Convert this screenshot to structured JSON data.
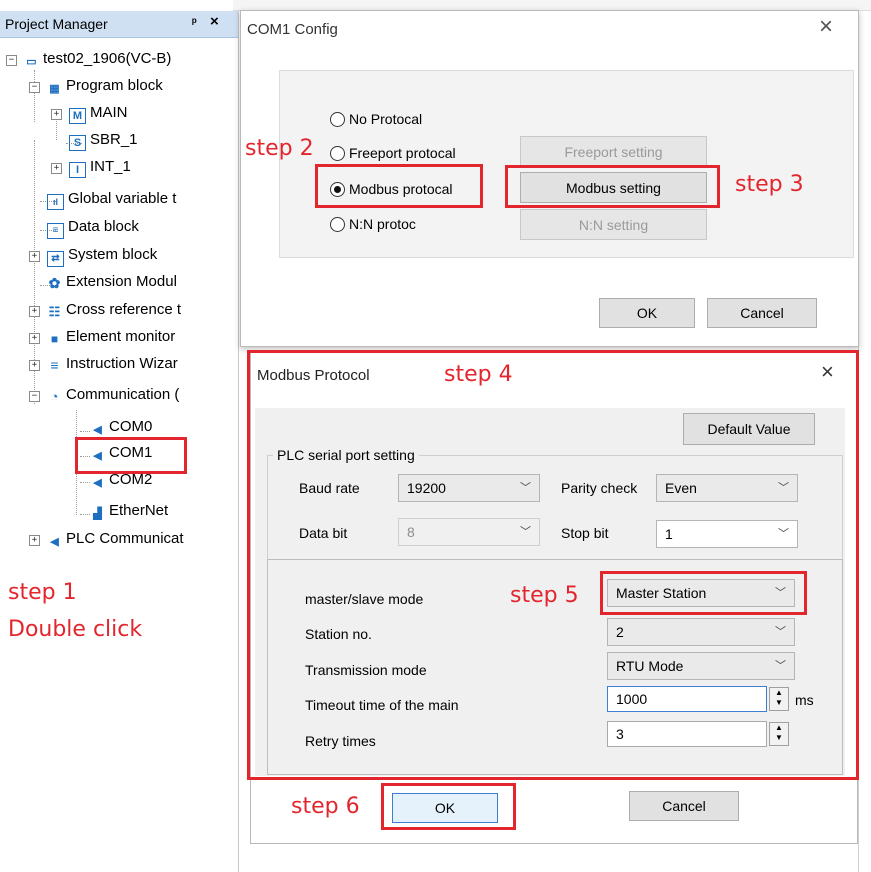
{
  "project_manager": {
    "title": "Project Manager",
    "pin_icon": "pin-icon",
    "close_icon": "close-icon",
    "items": [
      {
        "label": "test02_1906(VC-B)",
        "icon": "computer-icon"
      },
      {
        "label": "Program block",
        "icon": "program-block-icon"
      },
      {
        "label": "MAIN",
        "icon": "main-icon"
      },
      {
        "label": "SBR_1",
        "icon": "subroutine-icon"
      },
      {
        "label": "INT_1",
        "icon": "interrupt-icon"
      },
      {
        "label": "Global variable t",
        "icon": "chart-icon"
      },
      {
        "label": "Data block",
        "icon": "document-icon"
      },
      {
        "label": "System block",
        "icon": "system-block-icon"
      },
      {
        "label": "Extension Modul",
        "icon": "gear-icon"
      },
      {
        "label": "Cross reference t",
        "icon": "table-icon"
      },
      {
        "label": "Element monitor",
        "icon": "monitor-icon"
      },
      {
        "label": "Instruction Wizar",
        "icon": "list-icon"
      },
      {
        "label": "Communication (",
        "icon": "antenna-icon"
      },
      {
        "label": "COM0",
        "icon": "port-icon"
      },
      {
        "label": "COM1",
        "icon": "port-icon"
      },
      {
        "label": "COM2",
        "icon": "port-icon"
      },
      {
        "label": "EtherNet",
        "icon": "network-icon"
      },
      {
        "label": "PLC Communicat",
        "icon": "port-icon"
      }
    ]
  },
  "steps": {
    "step1": "step 1",
    "step1_sub": "Double click",
    "step2": "step 2",
    "step3": "step 3",
    "step4": "step 4",
    "step5": "step 5",
    "step6": "step 6"
  },
  "com1_dialog": {
    "title": "COM1 Config",
    "close_label": "×",
    "radios": [
      {
        "label": "No Protocal",
        "checked": false
      },
      {
        "label": "Freeport protocal",
        "checked": false
      },
      {
        "label": "Modbus protocal",
        "checked": true
      },
      {
        "label": "N:N protoc",
        "checked": false
      }
    ],
    "buttons": {
      "freeport": "Freeport setting",
      "modbus": "Modbus setting",
      "nn": "N:N setting",
      "ok": "OK",
      "cancel": "Cancel"
    }
  },
  "modbus_dialog": {
    "title": "Modbus Protocol",
    "close_label": "×",
    "default_value": "Default Value",
    "group_title": "PLC serial port setting",
    "baud_rate_label": "Baud rate",
    "baud_rate_value": "19200",
    "parity_label": "Parity check",
    "parity_value": "Even",
    "data_bit_label": "Data bit",
    "data_bit_value": "8",
    "stop_bit_label": "Stop bit",
    "stop_bit_value": "1",
    "mode_label": "master/slave mode",
    "mode_value": "Master Station",
    "station_label": "Station no.",
    "station_value": "2",
    "transmission_label": "Transmission mode",
    "transmission_value": "RTU Mode",
    "timeout_label": "Timeout time of the main",
    "timeout_value": "1000",
    "timeout_unit": "ms",
    "retry_label": "Retry times",
    "retry_value": "3",
    "ok": "OK",
    "cancel": "Cancel"
  },
  "colors": {
    "accent_red": "#e3262e",
    "header_blue": "#cfe0f3",
    "focus_blue": "#3c7fd0"
  }
}
